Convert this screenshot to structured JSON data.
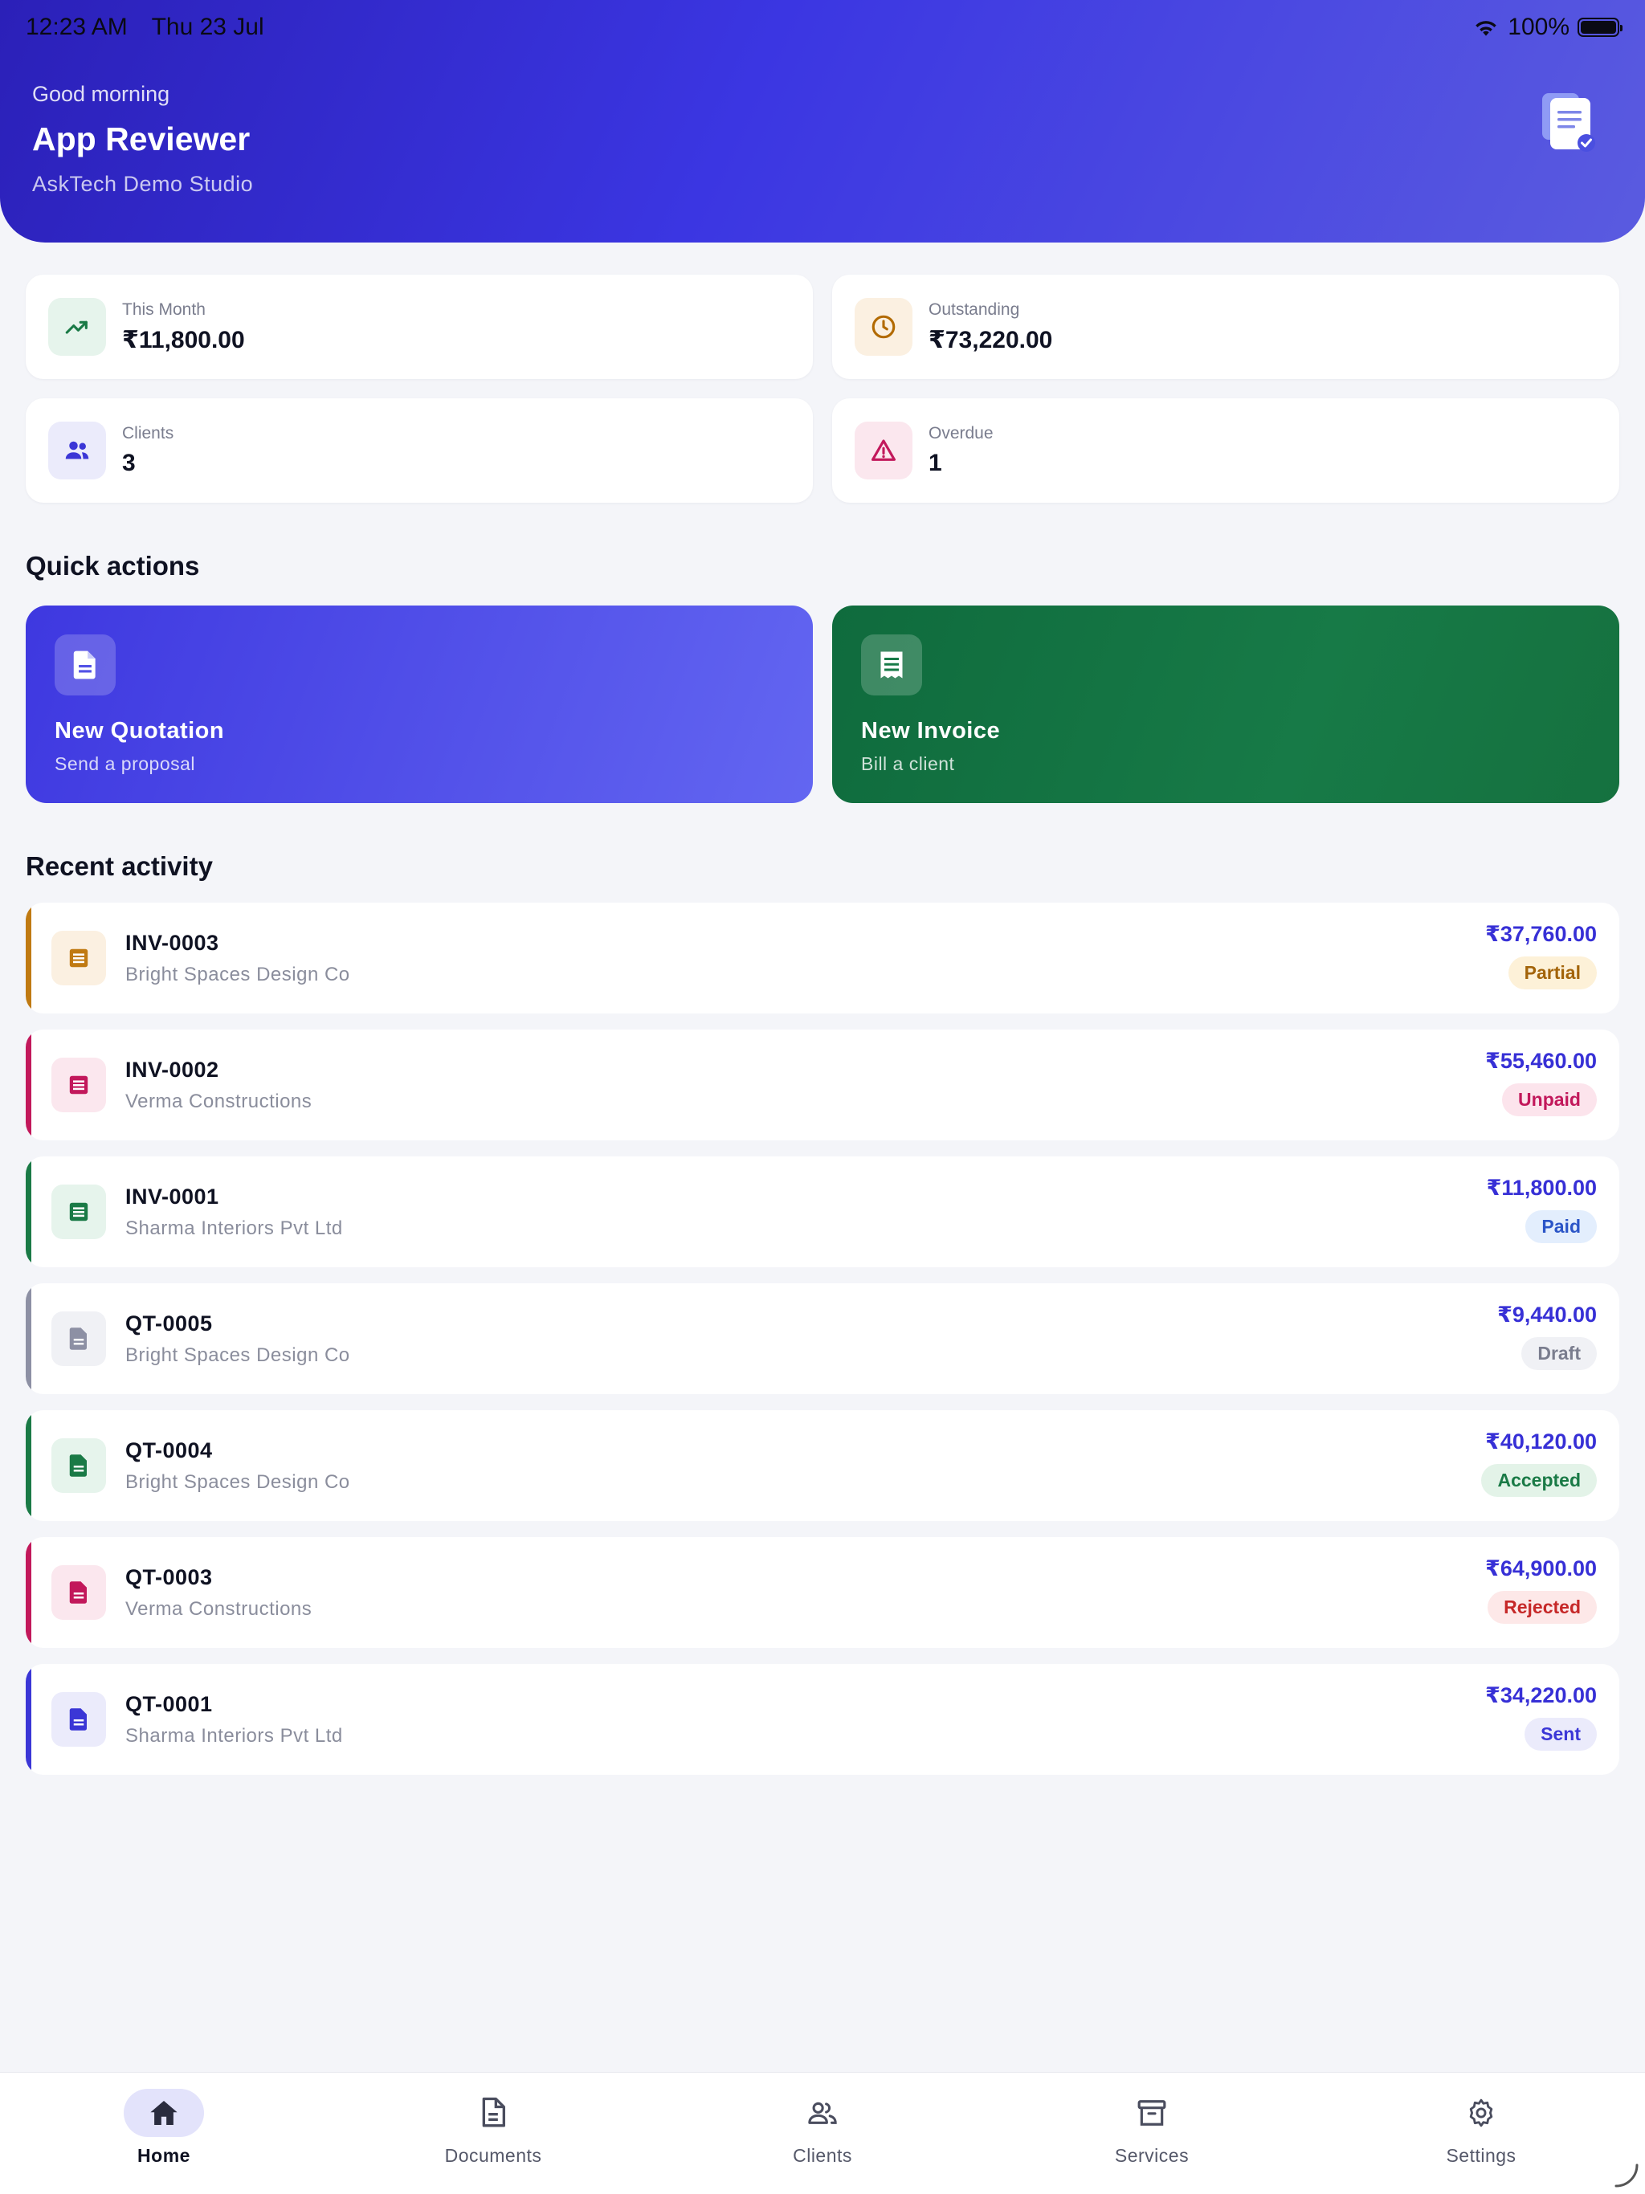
{
  "status_bar": {
    "time": "12:23 AM",
    "date": "Thu 23 Jul",
    "battery": "100%"
  },
  "header": {
    "greeting": "Good morning",
    "user_name": "App Reviewer",
    "studio": "AskTech Demo Studio",
    "logo_icon": "document-check-icon"
  },
  "stats": [
    {
      "label": "This Month",
      "value": "₹11,800.00",
      "icon": "trending-up-icon",
      "color": "#1a7a46",
      "bg": "#e6f4ec"
    },
    {
      "label": "Outstanding",
      "value": "₹73,220.00",
      "icon": "clock-icon",
      "color": "#b26a00",
      "bg": "#fbf0e1"
    },
    {
      "label": "Clients",
      "value": "3",
      "icon": "people-icon",
      "color": "#3b36d6",
      "bg": "#ebebfb"
    },
    {
      "label": "Overdue",
      "value": "1",
      "icon": "warning-icon",
      "color": "#c2185b",
      "bg": "#fbe7ee"
    }
  ],
  "sections": {
    "quick_actions": "Quick actions",
    "recent_activity": "Recent activity"
  },
  "quick_actions": [
    {
      "title": "New Quotation",
      "subtitle": "Send a proposal",
      "icon": "document-icon"
    },
    {
      "title": "New Invoice",
      "subtitle": "Bill a client",
      "icon": "receipt-icon"
    }
  ],
  "activity": [
    {
      "number": "INV-0003",
      "client": "Bright Spaces Design Co",
      "amount": "₹37,760.00",
      "status": "Partial",
      "kind": "invoice",
      "accent": "#c07a12",
      "icon_bg": "#fbf0e1",
      "badge_bg": "#fdf1d8",
      "badge_fg": "#a3640a"
    },
    {
      "number": "INV-0002",
      "client": "Verma Constructions",
      "amount": "₹55,460.00",
      "status": "Unpaid",
      "kind": "invoice",
      "accent": "#c2185b",
      "icon_bg": "#fbe7ee",
      "badge_bg": "#fce4ec",
      "badge_fg": "#c2185b"
    },
    {
      "number": "INV-0001",
      "client": "Sharma Interiors Pvt Ltd",
      "amount": "₹11,800.00",
      "status": "Paid",
      "kind": "invoice",
      "accent": "#1a7a46",
      "icon_bg": "#e6f4ec",
      "badge_bg": "#e3eefd",
      "badge_fg": "#2b55c7"
    },
    {
      "number": "QT-0005",
      "client": "Bright Spaces Design Co",
      "amount": "₹9,440.00",
      "status": "Draft",
      "kind": "quote",
      "accent": "#8d90a4",
      "icon_bg": "#f0f1f5",
      "badge_bg": "#f0f1f5",
      "badge_fg": "#7a7d8e"
    },
    {
      "number": "QT-0004",
      "client": "Bright Spaces Design Co",
      "amount": "₹40,120.00",
      "status": "Accepted",
      "kind": "quote",
      "accent": "#1a7a46",
      "icon_bg": "#e6f4ec",
      "badge_bg": "#e3f3e8",
      "badge_fg": "#1a7a46"
    },
    {
      "number": "QT-0003",
      "client": "Verma Constructions",
      "amount": "₹64,900.00",
      "status": "Rejected",
      "kind": "quote",
      "accent": "#c2185b",
      "icon_bg": "#fbe7ee",
      "badge_bg": "#fde8e8",
      "badge_fg": "#c62828"
    },
    {
      "number": "QT-0001",
      "client": "Sharma Interiors Pvt Ltd",
      "amount": "₹34,220.00",
      "status": "Sent",
      "kind": "quote",
      "accent": "#3b36d6",
      "icon_bg": "#ebebfb",
      "badge_bg": "#ebebfb",
      "badge_fg": "#3b36d6"
    }
  ],
  "nav": [
    {
      "label": "Home",
      "icon": "home-icon",
      "active": true
    },
    {
      "label": "Documents",
      "icon": "documents-icon",
      "active": false
    },
    {
      "label": "Clients",
      "icon": "clients-icon",
      "active": false
    },
    {
      "label": "Services",
      "icon": "archive-icon",
      "active": false
    },
    {
      "label": "Settings",
      "icon": "gear-icon",
      "active": false
    }
  ]
}
